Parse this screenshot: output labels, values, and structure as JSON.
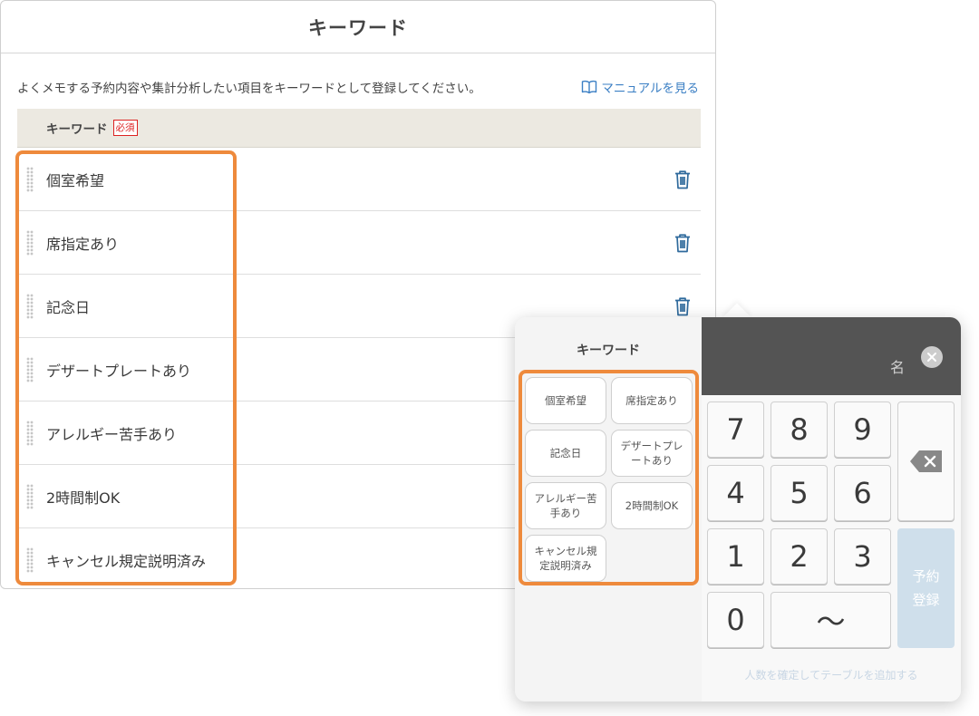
{
  "panel": {
    "title": "キーワード",
    "intro": "よくメモする予約内容や集計分析したい項目をキーワードとして登録してください。",
    "manual_link": "マニュアルを見る",
    "column_header": "キーワード",
    "required_badge": "必須",
    "keywords": [
      "個室希望",
      "席指定あり",
      "記念日",
      "デザートプレートあり",
      "アレルギー苦手あり",
      "2時間制OK",
      "キャンセル規定説明済み"
    ]
  },
  "popup": {
    "keyword_title": "キーワード",
    "keyword_buttons": [
      "個室希望",
      "席指定あり",
      "記念日",
      "デザートプレートあり",
      "アレルギー苦手あり",
      "2時間制OK",
      "キャンセル規定説明済み"
    ],
    "display_unit": "名",
    "keys": {
      "k7": "7",
      "k8": "8",
      "k9": "9",
      "k4": "4",
      "k5": "5",
      "k6": "6",
      "k1": "1",
      "k2": "2",
      "k3": "3",
      "k0": "0",
      "range": "〜"
    },
    "submit_line1": "予約",
    "submit_line2": "登録",
    "footer_note": "人数を確定してテーブルを追加する"
  },
  "colors": {
    "highlight": "#ee8a3c",
    "link": "#3b7fc4",
    "header_bg": "#ece9e1",
    "display_bg": "#545454",
    "submit_bg": "#cfdfeb",
    "required": "#dd2222"
  },
  "icons": [
    "book-icon",
    "grip-icon",
    "trash-icon",
    "close-icon",
    "backspace-icon"
  ]
}
